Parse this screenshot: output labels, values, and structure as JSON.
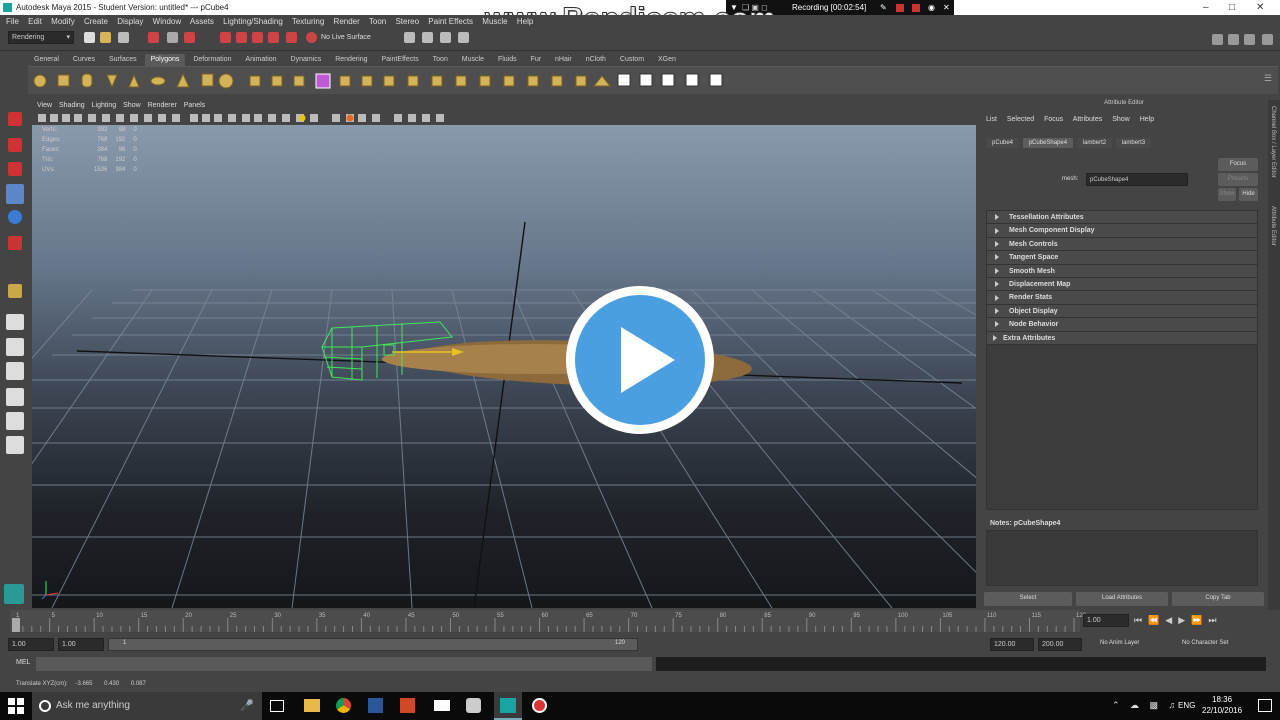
{
  "window": {
    "title": "Autodesk Maya 2015 - Student Version: untitled*   ---   pCube4"
  },
  "watermark": "www.Bandicam.com",
  "recording": {
    "label": "Recording [00:02:54]"
  },
  "menubar": [
    "File",
    "Edit",
    "Modify",
    "Create",
    "Display",
    "Window",
    "Assets",
    "Lighting/Shading",
    "Texturing",
    "Render",
    "Toon",
    "Stereo",
    "Paint Effects",
    "Muscle",
    "Help"
  ],
  "statusline": {
    "menuset": "Rendering",
    "live_surface": "No Live Surface"
  },
  "shelf_tabs": [
    "General",
    "Curves",
    "Surfaces",
    "Polygons",
    "Deformation",
    "Animation",
    "Dynamics",
    "Rendering",
    "PaintEffects",
    "Toon",
    "Muscle",
    "Fluids",
    "Fur",
    "nHair",
    "nCloth",
    "Custom",
    "XGen"
  ],
  "shelf_active": "Polygons",
  "panel_menu": [
    "View",
    "Shading",
    "Lighting",
    "Show",
    "Renderer",
    "Panels"
  ],
  "hud": [
    {
      "label": "Verts:",
      "a": "392",
      "b": "98",
      "c": "0"
    },
    {
      "label": "Edges:",
      "a": "768",
      "b": "192",
      "c": "0"
    },
    {
      "label": "Faces:",
      "a": "384",
      "b": "96",
      "c": "0"
    },
    {
      "label": "Tris:",
      "a": "768",
      "b": "192",
      "c": "0"
    },
    {
      "label": "UVs:",
      "a": "1536",
      "b": "384",
      "c": "0"
    }
  ],
  "attribute_editor": {
    "title": "Attribute Editor",
    "menu": [
      "List",
      "Selected",
      "Focus",
      "Attributes",
      "Show",
      "Help"
    ],
    "tabs": [
      "pCube4",
      "pCubeShape4",
      "lambert2",
      "lambert3"
    ],
    "active_tab": "pCubeShape4",
    "mesh_label": "mesh:",
    "mesh_value": "pCubeShape4",
    "focus_button": "Focus",
    "presets_button": "Presets",
    "show_button": "Show",
    "hide_button": "Hide",
    "sections": [
      "Tessellation Attributes",
      "Mesh Component Display",
      "Mesh Controls",
      "Tangent Space",
      "Smooth Mesh",
      "Displacement Map",
      "Render Stats",
      "Object Display",
      "Node Behavior",
      "Extra Attributes"
    ],
    "notes_label": "Notes: pCubeShape4",
    "bottom_buttons": [
      "Select",
      "Load Attributes",
      "Copy Tab"
    ]
  },
  "side_tabs": [
    "Channel Box / Layer Editor",
    "Attribute Editor"
  ],
  "timeline": {
    "ticks": [
      "1",
      "5",
      "10",
      "15",
      "20",
      "25",
      "30",
      "35",
      "40",
      "45",
      "50",
      "55",
      "60",
      "65",
      "70",
      "75",
      "80",
      "85",
      "90",
      "95",
      "100",
      "105",
      "110",
      "115",
      "120"
    ],
    "current_frame": "1.00",
    "range_start": "1.00",
    "range_start2": "1.00",
    "range_slider_start": "1",
    "range_slider_end": "120",
    "range_end": "120.00",
    "anim_end": "200.00",
    "anim_layer": "No Anim Layer",
    "character_set": "No Character Set"
  },
  "cmdline": {
    "label": "MEL"
  },
  "helpline": {
    "text": "Translate XYZ(cm):",
    "x": "-3.665",
    "y": "0.430",
    "z": "0.087"
  },
  "taskbar": {
    "search_placeholder": "Ask me anything",
    "lang": "ENG",
    "time": "18:36",
    "date": "22/10/2016"
  }
}
